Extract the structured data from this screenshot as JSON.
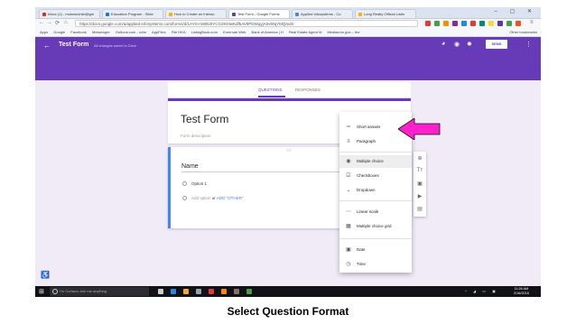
{
  "browser": {
    "tabs": [
      {
        "label": "Inbox (1) - motownchild@gm",
        "color": "#d93025",
        "active": false
      },
      {
        "label": "Education Program - Slide",
        "color": "#1a73e8",
        "active": false
      },
      {
        "label": "How to Create an Interac",
        "color": "#f9ab00",
        "active": false
      },
      {
        "label": "Test Form - Google Forms",
        "color": "#673ab7",
        "active": true
      },
      {
        "label": "Applied Infosystems - Co",
        "color": "#4285f4",
        "active": false
      },
      {
        "label": "Long Realty Official Listin",
        "color": "#f4b400",
        "active": false
      }
    ],
    "window_controls": "– ▢ ✕",
    "url": "https://docs.google.com/a/applied-infosystems.com/forms/d/1AYS-mWEdrYCG2KlHwKdf5AV8PDWqyjA0v5NjYMQ/edit",
    "bookmarks": [
      "Apps",
      "Google",
      "Facebook",
      "Messenger",
      "Outlook.com - robe",
      "AppFiles",
      "File HKA",
      "ListingBook.com",
      "Evernote Web",
      "Bank of America | H",
      "Real Estate Agent M",
      "Mediacom.gov – the",
      "Other bookmarks"
    ]
  },
  "form_header": {
    "title": "Test Form",
    "saved_status": "All changes saved in Drive",
    "send_label": "SEND",
    "icons": [
      "palette-icon",
      "preview-icon",
      "settings-icon",
      "more-icon"
    ]
  },
  "form_tabs": [
    "QUESTIONS",
    "RESPONSES"
  ],
  "form": {
    "title": "Test Form",
    "description": "Form description"
  },
  "question": {
    "title": "Name",
    "option1": "Option 1",
    "add_option": "Add option",
    "or_text": "or",
    "add_other": "ADD \"OTHER\""
  },
  "question_type_menu": {
    "selected": "Multiple choice",
    "items": [
      {
        "label": "Short answer",
        "icon": "short-answer-icon",
        "glyph": "═"
      },
      {
        "label": "Paragraph",
        "icon": "paragraph-icon",
        "glyph": "≡"
      },
      {
        "label": "Multiple choice",
        "icon": "radio-icon",
        "glyph": "◉"
      },
      {
        "label": "Checkboxes",
        "icon": "checkbox-icon",
        "glyph": "☑"
      },
      {
        "label": "Dropdown",
        "icon": "dropdown-icon",
        "glyph": "⌄"
      },
      {
        "label": "Linear scale",
        "icon": "linear-scale-icon",
        "glyph": "⋯"
      },
      {
        "label": "Multiple choice grid",
        "icon": "grid-icon",
        "glyph": "▦"
      },
      {
        "label": "Date",
        "icon": "date-icon",
        "glyph": "▣"
      },
      {
        "label": "Time",
        "icon": "time-icon",
        "glyph": "◷"
      }
    ]
  },
  "side_toolbar": [
    "add-question-icon",
    "add-title-icon",
    "add-image-icon",
    "add-video-icon",
    "add-section-icon"
  ],
  "taskbar": {
    "search_placeholder": "I'm Cortana. Ask me anything.",
    "time": "11:26 AM",
    "date": "2/16/2016"
  },
  "caption": "Select Question Format",
  "colors": {
    "accent": "#673ab7",
    "arrow": "#ff22cc",
    "question_border": "#4285f4"
  }
}
